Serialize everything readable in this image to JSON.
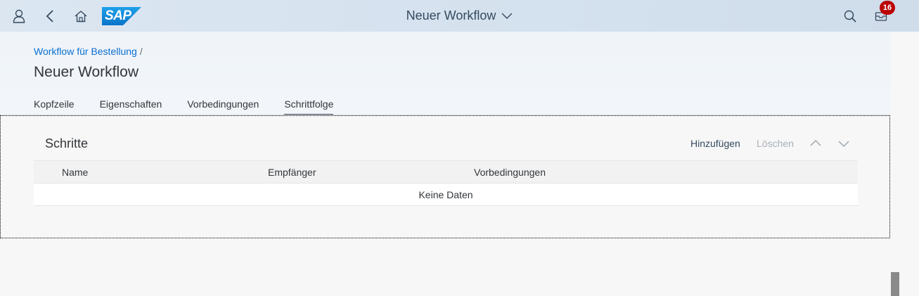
{
  "shell": {
    "title": "Neuer Workflow",
    "logo_text": "SAP",
    "notifications_count": "16",
    "icons": [
      "user-icon",
      "back-icon",
      "home-icon",
      "search-icon",
      "notifications-icon",
      "chevron-down-icon"
    ]
  },
  "header": {
    "breadcrumb": "Workflow für Bestellung",
    "breadcrumb_separator": "/",
    "title": "Neuer Workflow"
  },
  "tabs": [
    {
      "label": "Kopfzeile"
    },
    {
      "label": "Eigenschaften"
    },
    {
      "label": "Vorbedingungen"
    },
    {
      "label": "Schrittfolge",
      "active": true
    }
  ],
  "section": {
    "title": "Schritte",
    "toolbar": {
      "add_label": "Hinzufügen",
      "delete_label": "Löschen"
    },
    "table": {
      "columns": [
        "Name",
        "Empfänger",
        "Vorbedingungen"
      ],
      "no_data": "Keine Daten"
    }
  },
  "colors": {
    "accent": "#354a5f",
    "link": "#0a6ed1",
    "badge": "#bb0000",
    "disabled": "#a8b0b8"
  }
}
